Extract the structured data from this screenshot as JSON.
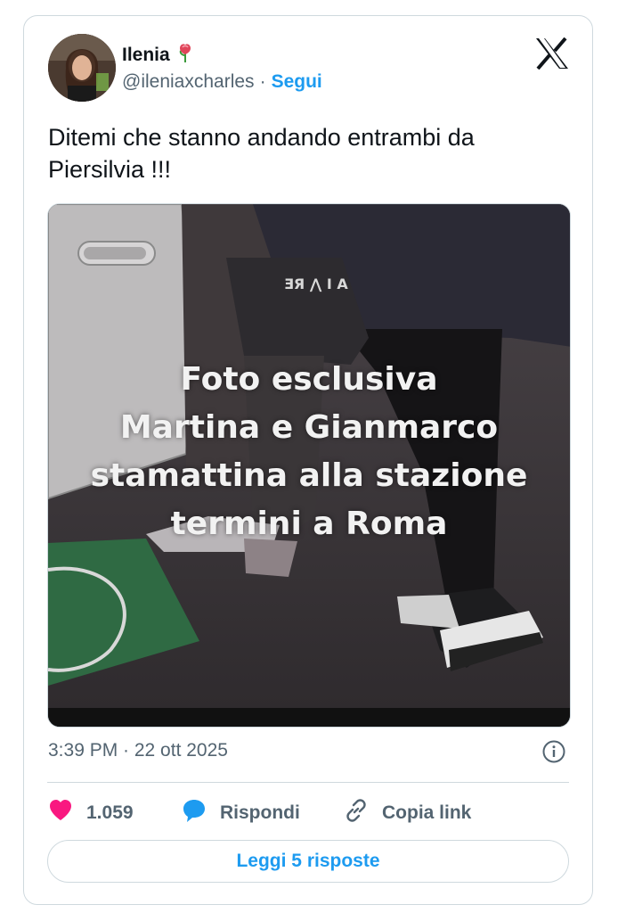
{
  "author": {
    "name": "Ilenia",
    "name_emoji_icon": "rose-icon",
    "handle": "@ileniaxcharles",
    "separator": "·",
    "follow_label": "Segui"
  },
  "brand": {
    "logo_icon": "x-logo-icon"
  },
  "tweet": {
    "text": "Ditemi che stanno andando entrambi da Piersilvia !!!",
    "media_caption_lines": [
      "Foto esclusiva",
      "Martina e Gianmarco",
      "stamattina alla stazione",
      "termini a Roma"
    ],
    "timestamp": "3:39 PM · 22 ott 2025"
  },
  "actions": {
    "like_count": "1.059",
    "reply_label": "Rispondi",
    "copy_link_label": "Copia link"
  },
  "footer": {
    "read_replies_label": "Leggi 5 risposte"
  },
  "colors": {
    "accent": "#1d9bf0",
    "like": "#f91880",
    "muted": "#536471",
    "border": "#cfd9de"
  }
}
